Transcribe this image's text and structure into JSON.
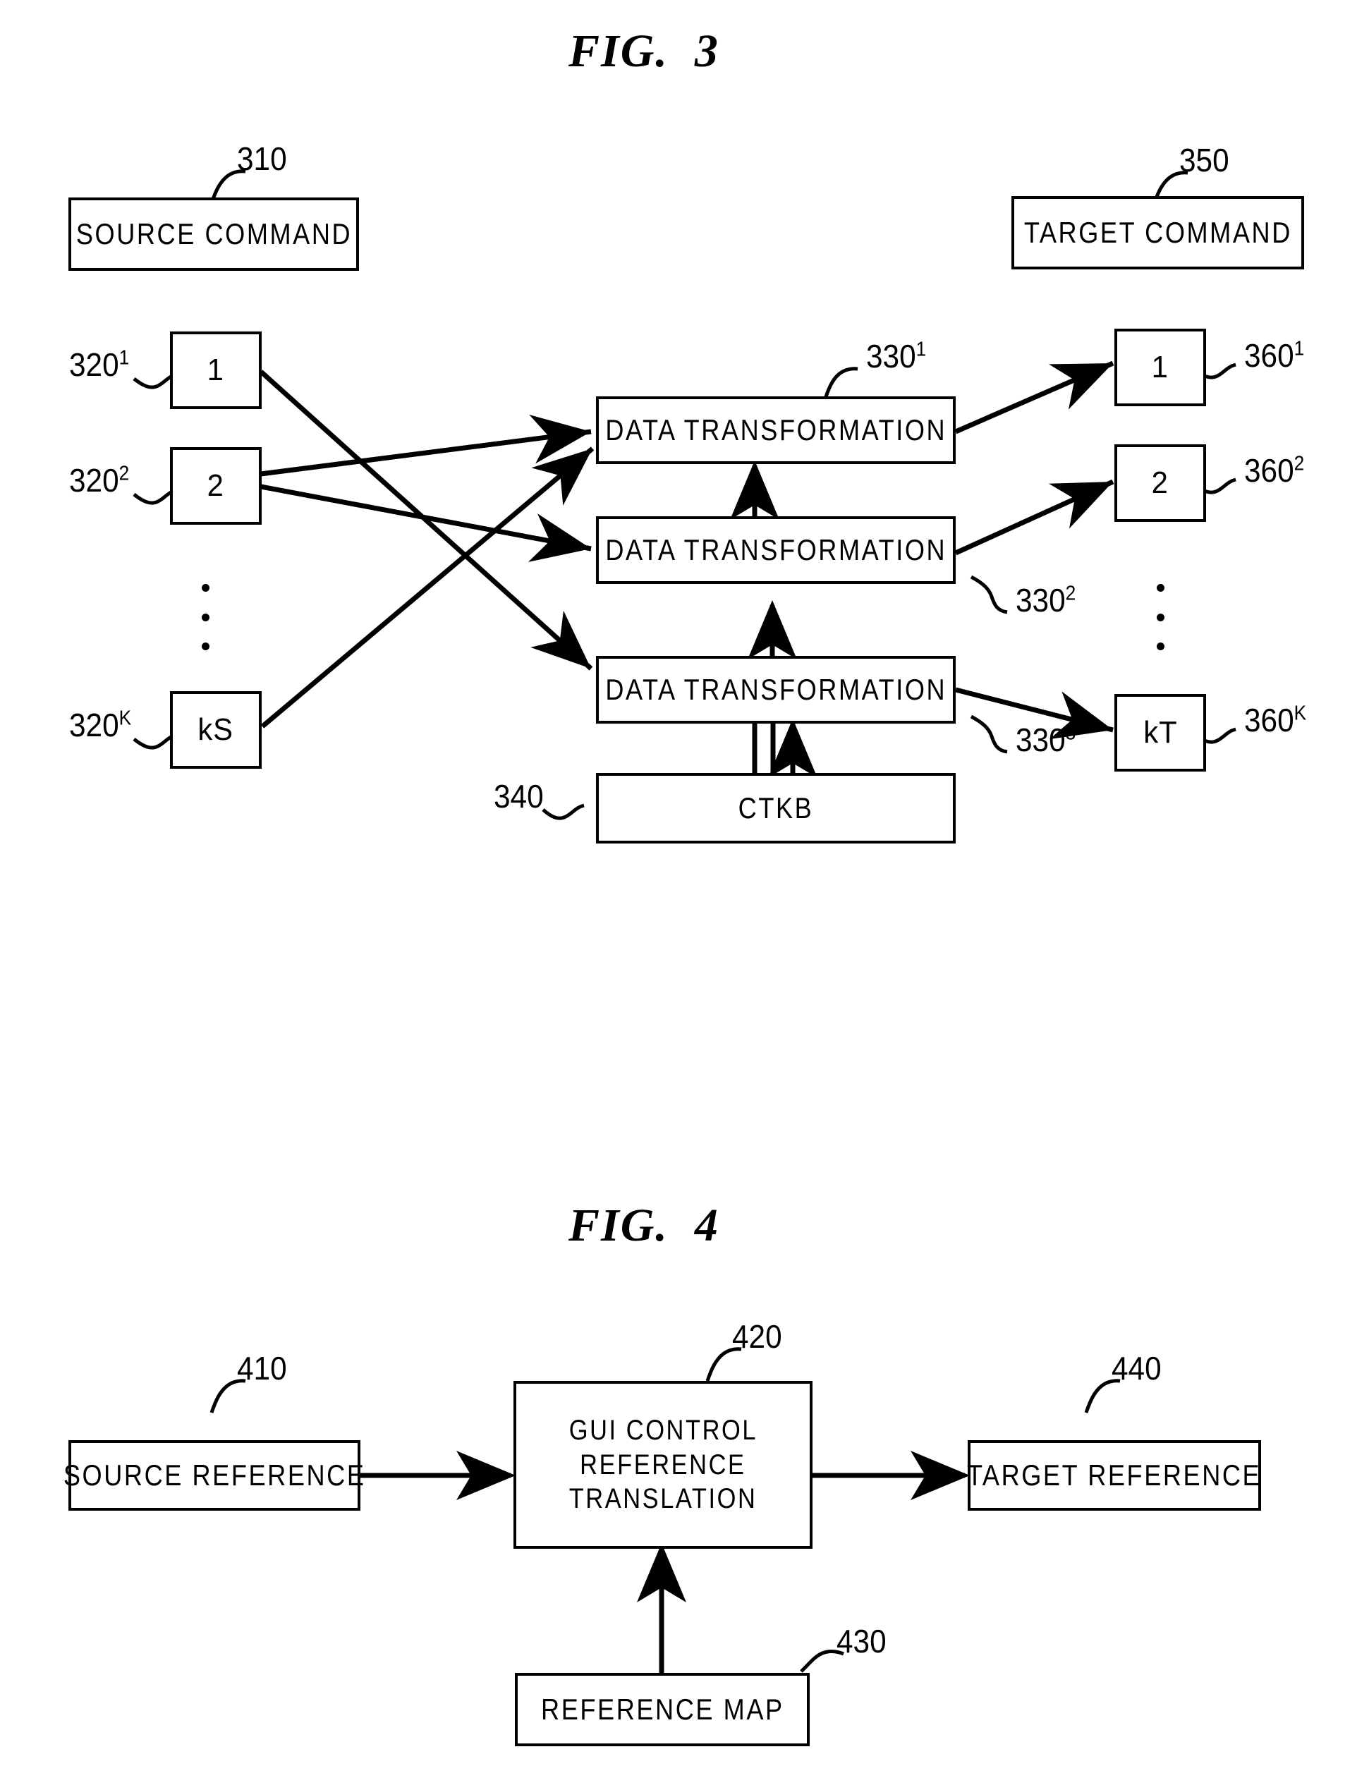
{
  "figures": [
    {
      "title": "FIG.  3",
      "nodes": {
        "source_command": "SOURCE COMMAND",
        "target_command": "TARGET COMMAND",
        "src_1": "1",
        "src_2": "2",
        "src_k": "kS",
        "dt_1": "DATA TRANSFORMATION",
        "dt_2": "DATA TRANSFORMATION",
        "dt_3": "DATA TRANSFORMATION",
        "ctkb": "CTKB",
        "tgt_1": "1",
        "tgt_2": "2",
        "tgt_k": "kT"
      },
      "refs": {
        "r310": {
          "base": "310",
          "sup": ""
        },
        "r350": {
          "base": "350",
          "sup": ""
        },
        "r320_1": {
          "base": "320",
          "sup": "1"
        },
        "r320_2": {
          "base": "320",
          "sup": "2"
        },
        "r320_k": {
          "base": "320",
          "sup": "K"
        },
        "r330_1": {
          "base": "330",
          "sup": "1"
        },
        "r330_2": {
          "base": "330",
          "sup": "2"
        },
        "r330_3": {
          "base": "330",
          "sup": "3"
        },
        "r340": {
          "base": "340",
          "sup": ""
        },
        "r360_1": {
          "base": "360",
          "sup": "1"
        },
        "r360_2": {
          "base": "360",
          "sup": "2"
        },
        "r360_k": {
          "base": "360",
          "sup": "K"
        }
      }
    },
    {
      "title": "FIG.  4",
      "nodes": {
        "source_reference": "SOURCE REFERENCE",
        "gui_control_line1": "GUI CONTROL",
        "gui_control_line2": "REFERENCE",
        "gui_control_line3": "TRANSLATION",
        "target_reference": "TARGET REFERENCE",
        "reference_map": "REFERENCE MAP"
      },
      "refs": {
        "r410": {
          "base": "410",
          "sup": ""
        },
        "r420": {
          "base": "420",
          "sup": ""
        },
        "r430": {
          "base": "430",
          "sup": ""
        },
        "r440": {
          "base": "440",
          "sup": ""
        }
      }
    }
  ],
  "style": {
    "ink": "#000000",
    "paper": "#ffffff"
  }
}
